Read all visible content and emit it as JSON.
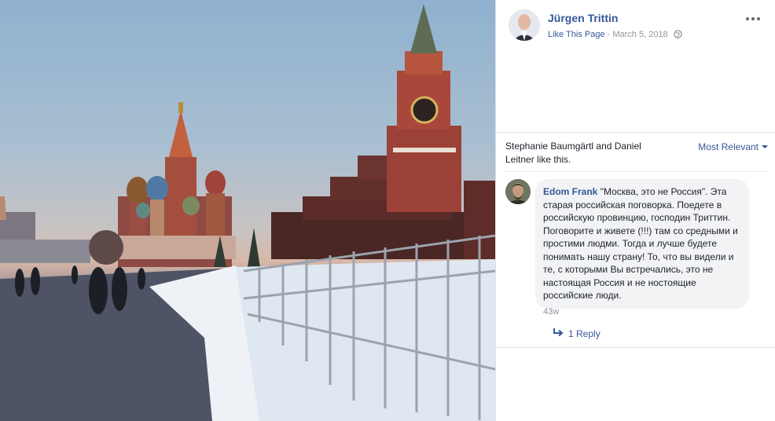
{
  "post": {
    "author": "Jürgen Trittin",
    "like_page": "Like This Page",
    "separator": " · ",
    "date": "March 5, 2018",
    "globe_icon": "globe-icon",
    "more_icon": "more-horizontal-icon"
  },
  "likes": {
    "text": "Stephanie Baumgärtl and Daniel Leitner like this.",
    "sort_label": "Most Relevant"
  },
  "comment": {
    "author": "Edom Frank",
    "text": "\"Москва, это не Россия\". Эта старая российская поговорка. Поедете в российскую провинцию, господин Триттин. Поговорите и живете (!!!) там со средными и простими людми. Тогда и лучше будете понимать нашу страну! То, что вы видели и те, с которыми Вы встречались, это не настоящая Россия и не ностоящие российские люди.",
    "time": "43w",
    "reply_label": "1 Reply"
  },
  "colors": {
    "link": "#365899",
    "meta": "#90949c",
    "bubble": "#f2f3f5",
    "divider": "#dddfe2"
  }
}
